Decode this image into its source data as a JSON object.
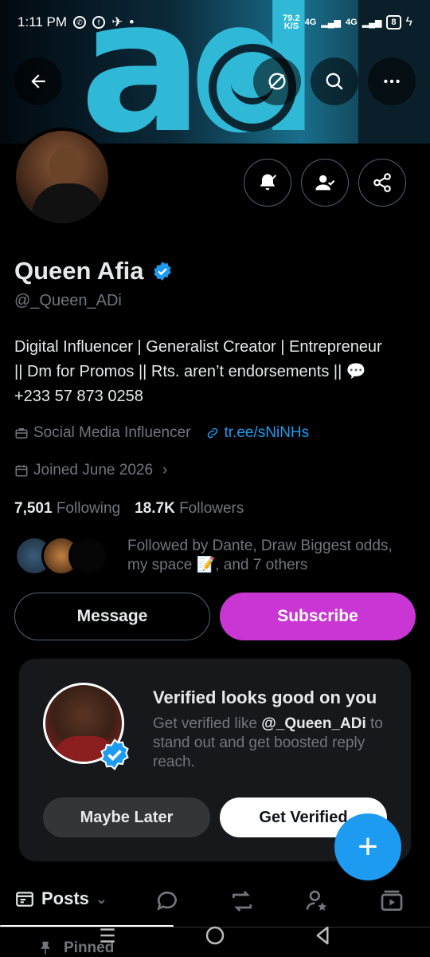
{
  "status_bar": {
    "time": "1:11 PM",
    "net_speed": "79.2",
    "net_unit": "K/S",
    "net_type_1": "4G",
    "net_type_2": "4G",
    "battery": "8"
  },
  "header": {
    "back_icon": "back-arrow-icon",
    "grok_icon": "grok-slash-icon",
    "search_icon": "search-icon",
    "more_icon": "more-dots-icon"
  },
  "profile": {
    "name": "Queen Afia",
    "handle": "@_Queen_ADi",
    "bio_line1": "Digital Influencer | Generalist Creator | Entrepreneur",
    "bio_line2": "|| Dm for Promos || Rts. aren’t endorsements || 💬",
    "bio_line3": "+233 57 873 0258",
    "category": "Social Media Influencer",
    "link": "tr.ee/sNiNHs",
    "joined": "Joined June 2026",
    "following_count": "7,501",
    "following_label": "Following",
    "followers_count": "18.7K",
    "followers_label": "Followers",
    "followed_by_line1": "Followed by Dante, Draw Biggest odds,",
    "followed_by_line2": "my space 📝, and 7 others"
  },
  "buttons": {
    "message": "Message",
    "subscribe": "Subscribe"
  },
  "verified_card": {
    "title": "Verified looks good on you",
    "desc_before": "Get verified like ",
    "desc_handle": "@_Queen_ADi",
    "desc_after": " to stand out and get boosted reply reach.",
    "maybe_later": "Maybe Later",
    "get_verified": "Get Verified"
  },
  "tabs": {
    "posts": "Posts"
  },
  "pinned": {
    "label": "Pinned"
  },
  "colors": {
    "accent_blue": "#1d9bf0",
    "subscribe_purple": "#c936d3",
    "muted": "#71767b"
  }
}
